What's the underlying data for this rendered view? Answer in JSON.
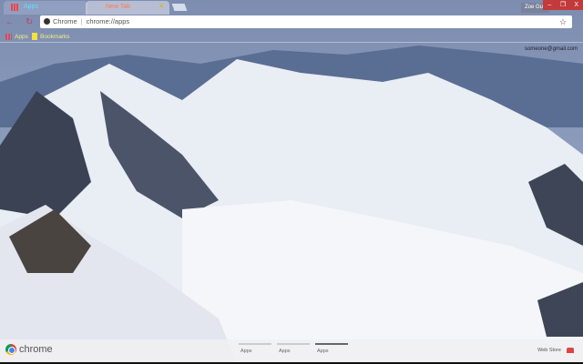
{
  "tabs": [
    {
      "label": "Apps",
      "active": true
    },
    {
      "label": "New Tab",
      "active": false
    }
  ],
  "user_label": "Zoe Guy",
  "window_controls": [
    "–",
    "❐",
    "X"
  ],
  "omnibox": {
    "chip": "Chrome",
    "url": "chrome://apps"
  },
  "bookmarks": [
    {
      "label": "Apps"
    },
    {
      "label": "Bookmarks"
    }
  ],
  "email": "someone@gmail.com",
  "footer": {
    "brand": "chrome",
    "pages": [
      {
        "label": "Apps",
        "active": false
      },
      {
        "label": "Apps",
        "active": false
      },
      {
        "label": "Apps",
        "active": true
      }
    ],
    "webstore": "Web Store"
  },
  "colors": {
    "accent": "#c23a3a",
    "tab_text": "#5fe0ff",
    "bookmark_text": "#f4f07a"
  }
}
